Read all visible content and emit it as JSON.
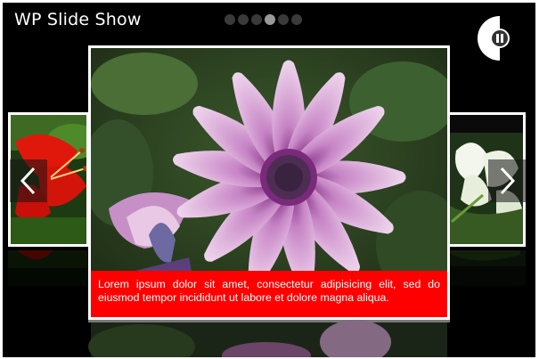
{
  "app": {
    "title": "WP Slide Show"
  },
  "pagination": {
    "count": 6,
    "active_index": 3
  },
  "controls": {
    "pause_icon": "pause-icon",
    "prev_icon": "chevron-left-icon",
    "next_icon": "chevron-right-icon"
  },
  "slides": {
    "current": {
      "image": "pink-daisy-photo",
      "caption": "Lorem ipsum dolor sit amet, consectetur adipisicing elit, sed do eiusmod tempor incididunt ut labore et dolore magna aliqua."
    },
    "previous": {
      "image": "red-lily-photo"
    },
    "next": {
      "image": "white-lily-photo"
    }
  },
  "colors": {
    "background": "#000000",
    "caption_bg": "#ff0000",
    "frame": "#ffffff",
    "dot_inactive": "#3a3a3a",
    "dot_active": "#9a9a9a"
  }
}
